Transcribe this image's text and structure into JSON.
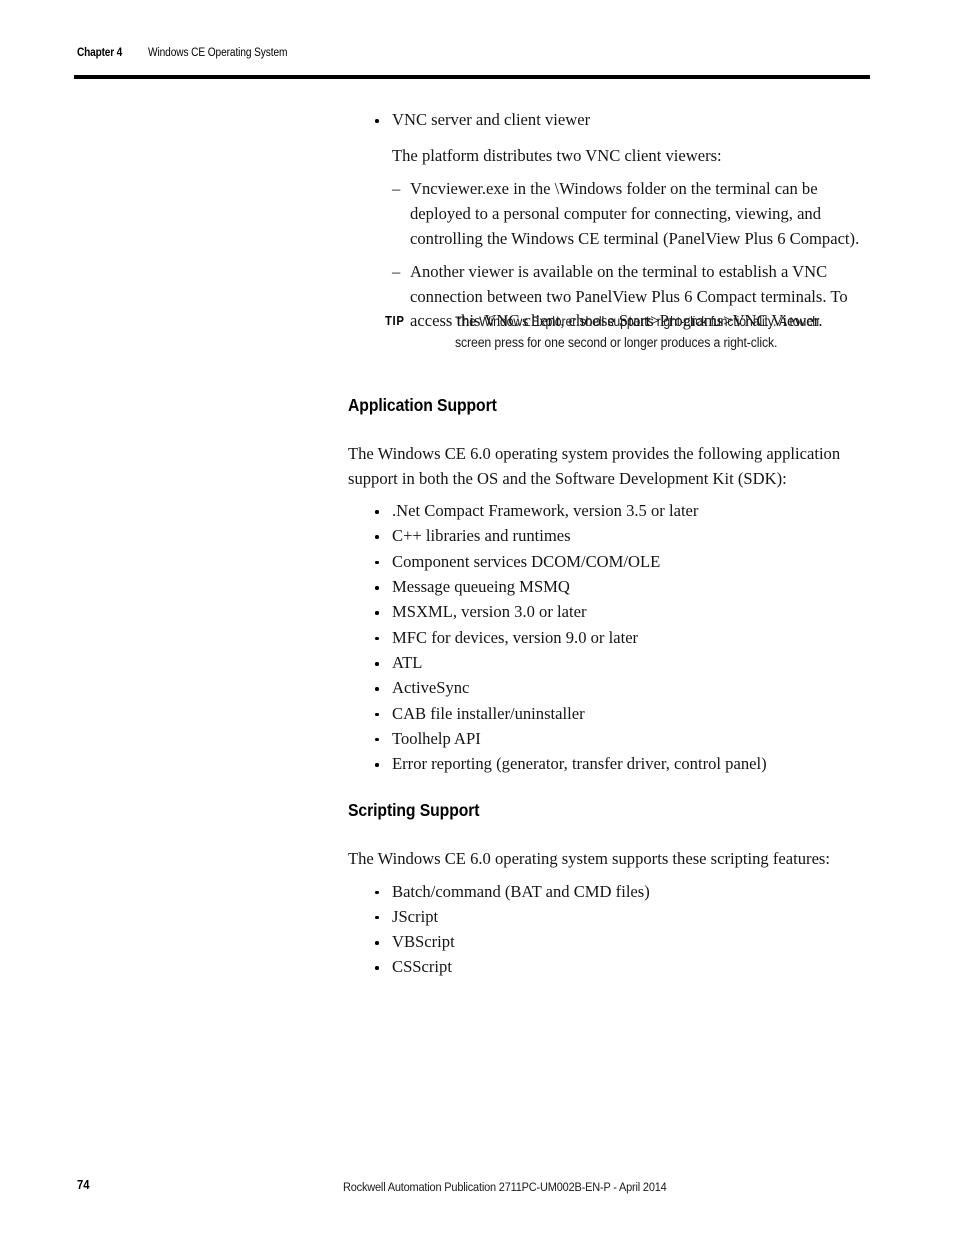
{
  "header": {
    "chapter_label": "Chapter 4",
    "chapter_title": "Windows CE Operating System"
  },
  "body": {
    "vnc": {
      "bullet": "VNC server and client viewer",
      "intro": "The platform distributes two VNC client viewers:",
      "sub_items": [
        "Vncviewer.exe in the \\Windows folder on the terminal can be deployed to a personal computer for connecting, viewing, and controlling the Windows CE terminal (PanelView Plus 6 Compact).",
        "Another viewer is available on the terminal to establish a VNC connection between two PanelView Plus 6 Compact terminals. To access this VNC client, choose Start>Programs>VNC Viewer."
      ]
    },
    "tip": {
      "label": "TIP",
      "text": "The Windows Explorer shell supports right-click functionality. A touch screen press for one second or longer produces a right-click."
    },
    "application_support": {
      "heading": "Application Support",
      "intro": "The Windows CE 6.0 operating system provides the following application support in both the OS and the Software Development Kit (SDK):",
      "items": [
        ".Net Compact Framework, version 3.5 or later",
        "C++ libraries and runtimes",
        "Component services DCOM/COM/OLE",
        "Message queueing MSMQ",
        "MSXML, version 3.0 or later",
        "MFC for devices, version 9.0 or later",
        "ATL",
        "ActiveSync",
        "CAB file installer/uninstaller",
        "Toolhelp API",
        "Error reporting (generator, transfer driver, control panel)"
      ]
    },
    "scripting_support": {
      "heading": "Scripting Support",
      "intro": "The Windows CE 6.0 operating system supports these scripting features:",
      "items": [
        "Batch/command (BAT and CMD files)",
        "JScript",
        "VBScript",
        "CSScript"
      ]
    }
  },
  "footer": {
    "page_number": "74",
    "publication": "Rockwell Automation Publication 2711PC-UM002B-EN-P - April 2014"
  }
}
